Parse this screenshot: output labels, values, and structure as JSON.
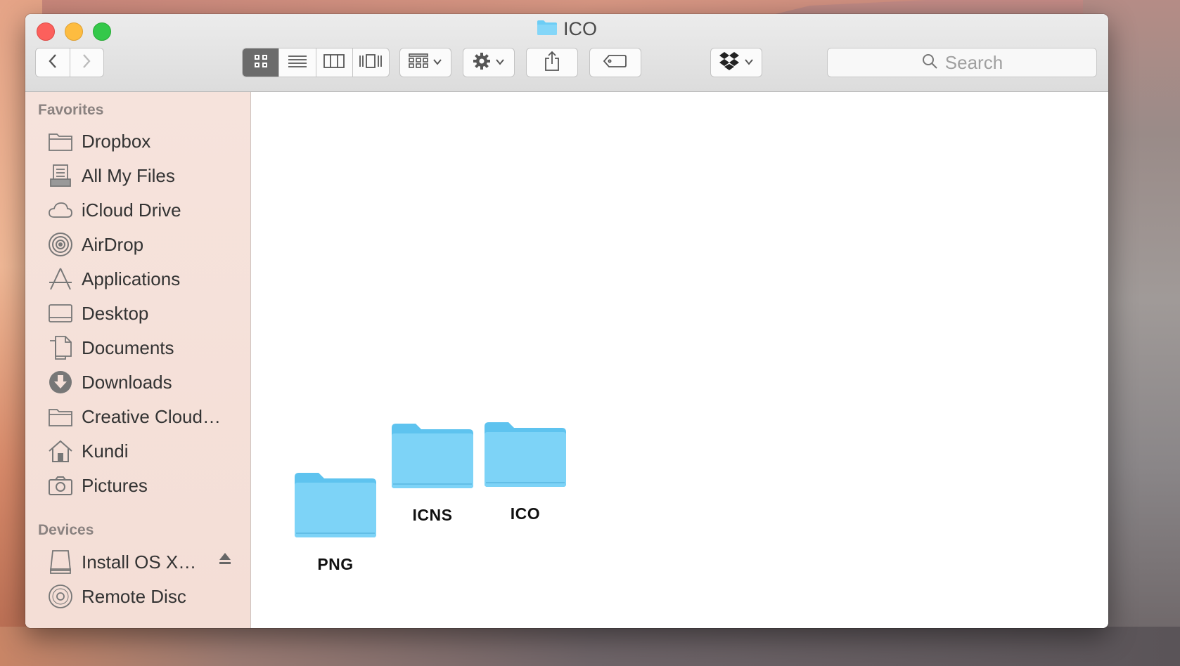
{
  "window": {
    "title": "ICO"
  },
  "toolbar": {
    "back_icon": "chevron-left-icon",
    "forward_icon": "chevron-right-icon",
    "view_modes": [
      "icon-view",
      "list-view",
      "column-view",
      "coverflow-view"
    ],
    "active_view": "icon-view",
    "search_placeholder": "Search"
  },
  "sidebar": {
    "favorites_title": "Favorites",
    "favorites": [
      {
        "label": "Dropbox",
        "icon": "folder-icon"
      },
      {
        "label": "All My Files",
        "icon": "all-files-icon"
      },
      {
        "label": "iCloud Drive",
        "icon": "cloud-icon"
      },
      {
        "label": "AirDrop",
        "icon": "airdrop-icon"
      },
      {
        "label": "Applications",
        "icon": "applications-icon"
      },
      {
        "label": "Desktop",
        "icon": "desktop-icon"
      },
      {
        "label": "Documents",
        "icon": "documents-icon"
      },
      {
        "label": "Downloads",
        "icon": "downloads-icon"
      },
      {
        "label": "Creative Cloud…",
        "icon": "folder-icon"
      },
      {
        "label": "Kundi",
        "icon": "home-icon"
      },
      {
        "label": "Pictures",
        "icon": "camera-icon"
      }
    ],
    "devices_title": "Devices",
    "devices": [
      {
        "label": "Install OS X…",
        "icon": "drive-icon"
      },
      {
        "label": "Remote Disc",
        "icon": "disc-icon"
      }
    ]
  },
  "content": {
    "folders": [
      {
        "name": "PNG"
      },
      {
        "name": "ICNS"
      },
      {
        "name": "ICO"
      }
    ]
  },
  "colors": {
    "folder_blue": "#6ccdf5",
    "close": "#fc605c",
    "minimize": "#fdbc40",
    "maximize": "#34c84a"
  }
}
